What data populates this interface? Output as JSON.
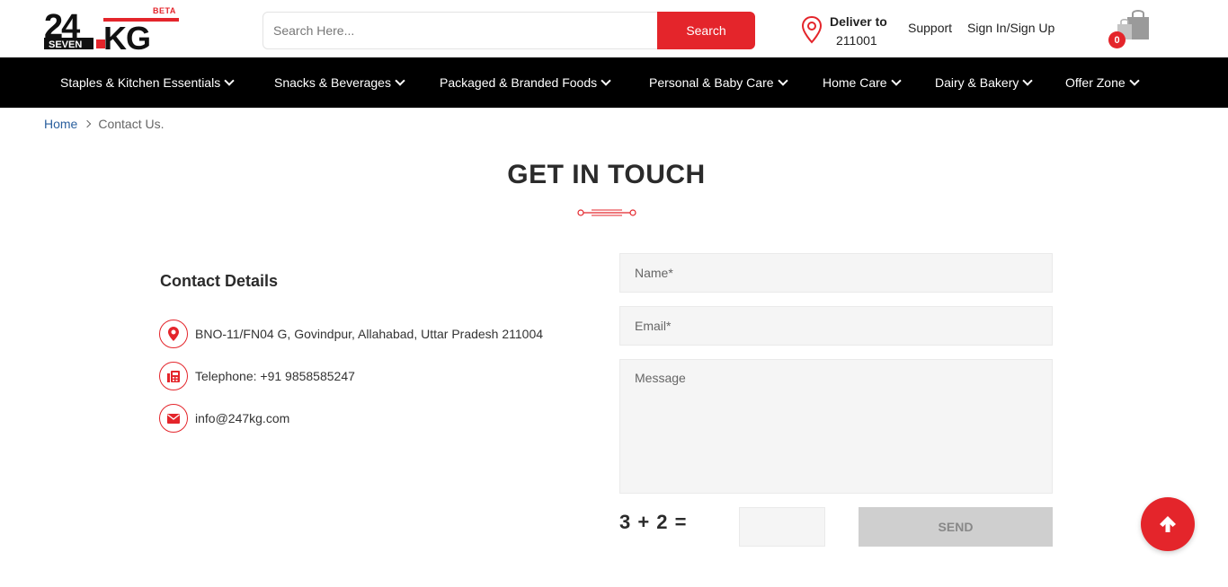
{
  "header": {
    "logo_text": "24 SEVEN KG",
    "beta_label": "BETA",
    "search": {
      "placeholder": "Search Here...",
      "button_label": "Search"
    },
    "deliver": {
      "label": "Deliver to",
      "pincode": "211001"
    },
    "support_label": "Support",
    "signin_label": "Sign In/Sign Up",
    "cart_count": "0"
  },
  "nav": {
    "items": [
      {
        "label": "Staples & Kitchen Essentials"
      },
      {
        "label": "Snacks & Beverages"
      },
      {
        "label": "Packaged & Branded Foods"
      },
      {
        "label": "Personal & Baby Care"
      },
      {
        "label": "Home Care"
      },
      {
        "label": "Dairy & Bakery"
      },
      {
        "label": "Offer Zone"
      }
    ]
  },
  "breadcrumb": {
    "home": "Home",
    "current": "Contact Us."
  },
  "page": {
    "title": "GET IN TOUCH"
  },
  "contact": {
    "title": "Contact Details",
    "address": "BNO-11/FN04 G, Govindpur, Allahabad, Uttar Pradesh 211004",
    "telephone": "Telephone: +91 9858585247",
    "email": "info@247kg.com"
  },
  "form": {
    "name_placeholder": "Name*",
    "email_placeholder": "Email*",
    "message_placeholder": "Message",
    "captcha_question": "3 + 2 =",
    "send_label": "SEND"
  },
  "colors": {
    "accent": "#e4252b",
    "nav_background": "#000000",
    "link": "#2a5f9e"
  },
  "icons": {
    "location": "map-pin-icon",
    "cart": "shopping-bag-icon",
    "address": "map-marker-icon",
    "phone": "fax-icon",
    "email": "envelope-icon",
    "back_to_top": "arrow-up-icon"
  }
}
